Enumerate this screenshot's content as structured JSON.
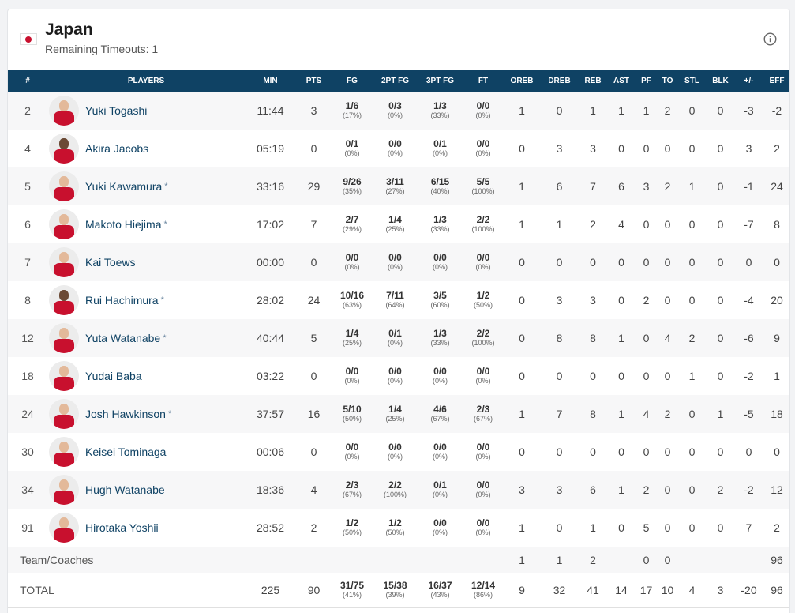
{
  "team": {
    "name": "Japan",
    "timeouts_label": "Remaining Timeouts: 1"
  },
  "colors": {
    "header_bg": "#0f4264",
    "player_link": "#0f4264",
    "jersey": "#c8102e",
    "flag_dot": "#c8102e"
  },
  "icons": {
    "flag": "japan-flag-icon",
    "info": "info-icon"
  },
  "columns": [
    "#",
    "PLAYERS",
    "MIN",
    "PTS",
    "FG",
    "2PT FG",
    "3PT FG",
    "FT",
    "OREB",
    "DREB",
    "REB",
    "AST",
    "PF",
    "TO",
    "STL",
    "BLK",
    "+/-",
    "EFF"
  ],
  "players": [
    {
      "num": "2",
      "name": "Yuki Togashi",
      "starter": false,
      "min": "11:44",
      "pts": "3",
      "fg": "1/6",
      "fg_pct": "(17%)",
      "fg2": "0/3",
      "fg2_pct": "(0%)",
      "fg3": "1/3",
      "fg3_pct": "(33%)",
      "ft": "0/0",
      "ft_pct": "(0%)",
      "oreb": "1",
      "dreb": "0",
      "reb": "1",
      "ast": "1",
      "pf": "1",
      "to": "2",
      "stl": "0",
      "blk": "0",
      "pm": "-3",
      "eff": "-2"
    },
    {
      "num": "4",
      "name": "Akira Jacobs",
      "starter": false,
      "min": "05:19",
      "pts": "0",
      "fg": "0/1",
      "fg_pct": "(0%)",
      "fg2": "0/0",
      "fg2_pct": "(0%)",
      "fg3": "0/1",
      "fg3_pct": "(0%)",
      "ft": "0/0",
      "ft_pct": "(0%)",
      "oreb": "0",
      "dreb": "3",
      "reb": "3",
      "ast": "0",
      "pf": "0",
      "to": "0",
      "stl": "0",
      "blk": "0",
      "pm": "3",
      "eff": "2"
    },
    {
      "num": "5",
      "name": "Yuki Kawamura",
      "starter": true,
      "min": "33:16",
      "pts": "29",
      "fg": "9/26",
      "fg_pct": "(35%)",
      "fg2": "3/11",
      "fg2_pct": "(27%)",
      "fg3": "6/15",
      "fg3_pct": "(40%)",
      "ft": "5/5",
      "ft_pct": "(100%)",
      "oreb": "1",
      "dreb": "6",
      "reb": "7",
      "ast": "6",
      "pf": "3",
      "to": "2",
      "stl": "1",
      "blk": "0",
      "pm": "-1",
      "eff": "24"
    },
    {
      "num": "6",
      "name": "Makoto Hiejima",
      "starter": true,
      "min": "17:02",
      "pts": "7",
      "fg": "2/7",
      "fg_pct": "(29%)",
      "fg2": "1/4",
      "fg2_pct": "(25%)",
      "fg3": "1/3",
      "fg3_pct": "(33%)",
      "ft": "2/2",
      "ft_pct": "(100%)",
      "oreb": "1",
      "dreb": "1",
      "reb": "2",
      "ast": "4",
      "pf": "0",
      "to": "0",
      "stl": "0",
      "blk": "0",
      "pm": "-7",
      "eff": "8"
    },
    {
      "num": "7",
      "name": "Kai Toews",
      "starter": false,
      "min": "00:00",
      "pts": "0",
      "fg": "0/0",
      "fg_pct": "(0%)",
      "fg2": "0/0",
      "fg2_pct": "(0%)",
      "fg3": "0/0",
      "fg3_pct": "(0%)",
      "ft": "0/0",
      "ft_pct": "(0%)",
      "oreb": "0",
      "dreb": "0",
      "reb": "0",
      "ast": "0",
      "pf": "0",
      "to": "0",
      "stl": "0",
      "blk": "0",
      "pm": "0",
      "eff": "0"
    },
    {
      "num": "8",
      "name": "Rui Hachimura",
      "starter": true,
      "min": "28:02",
      "pts": "24",
      "fg": "10/16",
      "fg_pct": "(63%)",
      "fg2": "7/11",
      "fg2_pct": "(64%)",
      "fg3": "3/5",
      "fg3_pct": "(60%)",
      "ft": "1/2",
      "ft_pct": "(50%)",
      "oreb": "0",
      "dreb": "3",
      "reb": "3",
      "ast": "0",
      "pf": "2",
      "to": "0",
      "stl": "0",
      "blk": "0",
      "pm": "-4",
      "eff": "20"
    },
    {
      "num": "12",
      "name": "Yuta Watanabe",
      "starter": true,
      "min": "40:44",
      "pts": "5",
      "fg": "1/4",
      "fg_pct": "(25%)",
      "fg2": "0/1",
      "fg2_pct": "(0%)",
      "fg3": "1/3",
      "fg3_pct": "(33%)",
      "ft": "2/2",
      "ft_pct": "(100%)",
      "oreb": "0",
      "dreb": "8",
      "reb": "8",
      "ast": "1",
      "pf": "0",
      "to": "4",
      "stl": "2",
      "blk": "0",
      "pm": "-6",
      "eff": "9"
    },
    {
      "num": "18",
      "name": "Yudai Baba",
      "starter": false,
      "min": "03:22",
      "pts": "0",
      "fg": "0/0",
      "fg_pct": "(0%)",
      "fg2": "0/0",
      "fg2_pct": "(0%)",
      "fg3": "0/0",
      "fg3_pct": "(0%)",
      "ft": "0/0",
      "ft_pct": "(0%)",
      "oreb": "0",
      "dreb": "0",
      "reb": "0",
      "ast": "0",
      "pf": "0",
      "to": "0",
      "stl": "1",
      "blk": "0",
      "pm": "-2",
      "eff": "1"
    },
    {
      "num": "24",
      "name": "Josh Hawkinson",
      "starter": true,
      "min": "37:57",
      "pts": "16",
      "fg": "5/10",
      "fg_pct": "(50%)",
      "fg2": "1/4",
      "fg2_pct": "(25%)",
      "fg3": "4/6",
      "fg3_pct": "(67%)",
      "ft": "2/3",
      "ft_pct": "(67%)",
      "oreb": "1",
      "dreb": "7",
      "reb": "8",
      "ast": "1",
      "pf": "4",
      "to": "2",
      "stl": "0",
      "blk": "1",
      "pm": "-5",
      "eff": "18"
    },
    {
      "num": "30",
      "name": "Keisei Tominaga",
      "starter": false,
      "min": "00:06",
      "pts": "0",
      "fg": "0/0",
      "fg_pct": "(0%)",
      "fg2": "0/0",
      "fg2_pct": "(0%)",
      "fg3": "0/0",
      "fg3_pct": "(0%)",
      "ft": "0/0",
      "ft_pct": "(0%)",
      "oreb": "0",
      "dreb": "0",
      "reb": "0",
      "ast": "0",
      "pf": "0",
      "to": "0",
      "stl": "0",
      "blk": "0",
      "pm": "0",
      "eff": "0"
    },
    {
      "num": "34",
      "name": "Hugh Watanabe",
      "starter": false,
      "min": "18:36",
      "pts": "4",
      "fg": "2/3",
      "fg_pct": "(67%)",
      "fg2": "2/2",
      "fg2_pct": "(100%)",
      "fg3": "0/1",
      "fg3_pct": "(0%)",
      "ft": "0/0",
      "ft_pct": "(0%)",
      "oreb": "3",
      "dreb": "3",
      "reb": "6",
      "ast": "1",
      "pf": "2",
      "to": "0",
      "stl": "0",
      "blk": "2",
      "pm": "-2",
      "eff": "12"
    },
    {
      "num": "91",
      "name": "Hirotaka Yoshii",
      "starter": false,
      "min": "28:52",
      "pts": "2",
      "fg": "1/2",
      "fg_pct": "(50%)",
      "fg2": "1/2",
      "fg2_pct": "(50%)",
      "fg3": "0/0",
      "fg3_pct": "(0%)",
      "ft": "0/0",
      "ft_pct": "(0%)",
      "oreb": "1",
      "dreb": "0",
      "reb": "1",
      "ast": "0",
      "pf": "5",
      "to": "0",
      "stl": "0",
      "blk": "0",
      "pm": "7",
      "eff": "2"
    }
  ],
  "team_row": {
    "label": "Team/Coaches",
    "oreb": "1",
    "dreb": "1",
    "reb": "2",
    "pf": "0",
    "to": "0",
    "eff": "96"
  },
  "total_row": {
    "label": "TOTAL",
    "min": "225",
    "pts": "90",
    "fg": "31/75",
    "fg_pct": "(41%)",
    "fg2": "15/38",
    "fg2_pct": "(39%)",
    "fg3": "16/37",
    "fg3_pct": "(43%)",
    "ft": "12/14",
    "ft_pct": "(86%)",
    "oreb": "9",
    "dreb": "32",
    "reb": "41",
    "ast": "14",
    "pf": "17",
    "to": "10",
    "stl": "4",
    "blk": "3",
    "pm": "-20",
    "eff": "96"
  }
}
